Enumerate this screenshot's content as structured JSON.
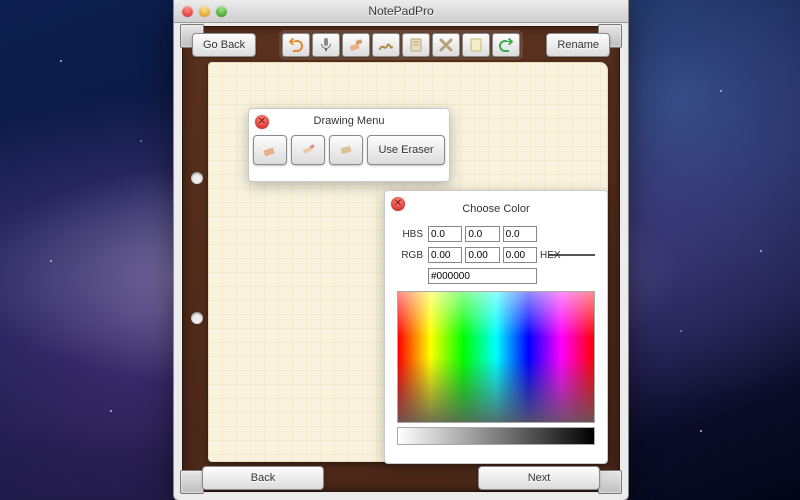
{
  "window": {
    "title": "NotePadPro"
  },
  "topbar": {
    "go_back": "Go Back",
    "rename": "Rename",
    "tools": {
      "undo": "undo-icon",
      "mic": "microphone-icon",
      "eraser_brush": "eraser-brush-icon",
      "scribble": "scribble-icon",
      "note": "note-icon",
      "delete_x": "delete-icon",
      "page": "page-icon",
      "redo": "redo-icon"
    }
  },
  "drawing_menu": {
    "title": "Drawing Menu",
    "use_eraser": "Use Eraser"
  },
  "color_panel": {
    "title": "Choose Color",
    "labels": {
      "hbs": "HBS",
      "rgb": "RGB",
      "hex": "HEX"
    },
    "hbs": [
      "0.0",
      "0.0",
      "0.0"
    ],
    "rgb": [
      "0.00",
      "0.00",
      "0.00"
    ],
    "hex": "#000000",
    "swatch": "#000000"
  },
  "bottombar": {
    "back": "Back",
    "next": "Next"
  }
}
